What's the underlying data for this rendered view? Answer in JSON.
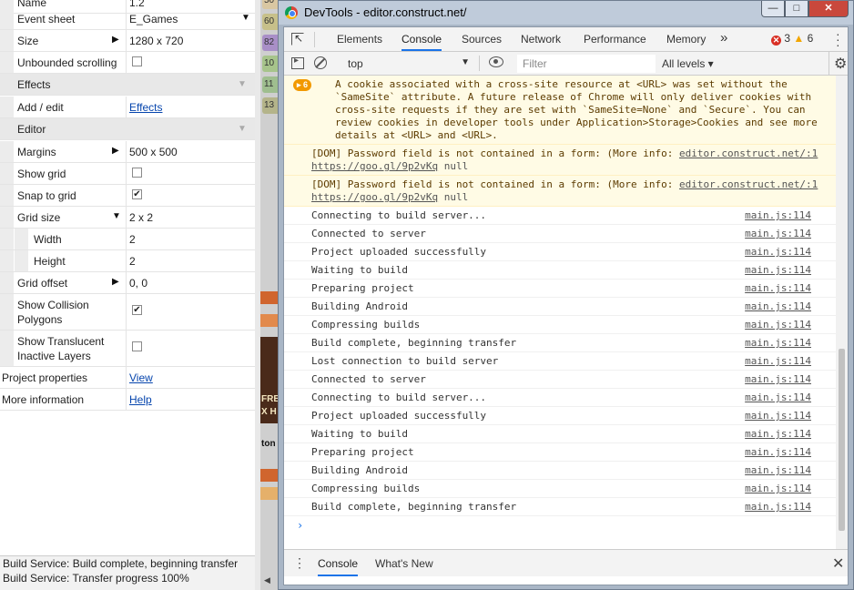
{
  "properties": {
    "rows": [
      {
        "type": "prop",
        "label": "Name",
        "value": "1.2"
      },
      {
        "type": "prop",
        "label": "Event sheet",
        "value": "E_Games",
        "control": "dropdown"
      },
      {
        "type": "prop",
        "label": "Size",
        "value": "1280 x 720",
        "control": "expand"
      },
      {
        "type": "prop",
        "label": "Unbounded scrolling",
        "control": "checkbox",
        "checked": false
      },
      {
        "type": "section",
        "label": "Effects"
      },
      {
        "type": "prop",
        "label": "Add / edit",
        "link": "Effects"
      },
      {
        "type": "section",
        "label": "Editor"
      },
      {
        "type": "prop",
        "label": "Margins",
        "value": "500 x 500",
        "control": "expand"
      },
      {
        "type": "prop",
        "label": "Show grid",
        "control": "checkbox",
        "checked": false
      },
      {
        "type": "prop",
        "label": "Snap to grid",
        "control": "checkbox",
        "checked": true
      },
      {
        "type": "prop",
        "label": "Grid size",
        "value": "2 x 2",
        "control": "expanded"
      },
      {
        "type": "sub",
        "label": "Width",
        "value": "2"
      },
      {
        "type": "sub",
        "label": "Height",
        "value": "2"
      },
      {
        "type": "prop",
        "label": "Grid offset",
        "value": "0, 0",
        "control": "expand"
      },
      {
        "type": "prop2",
        "label": "Show Collision Polygons",
        "control": "checkbox",
        "checked": true
      },
      {
        "type": "prop2",
        "label": "Show Translucent Inactive Layers",
        "control": "checkbox",
        "checked": false
      },
      {
        "type": "root",
        "label": "Project properties",
        "link": "View"
      },
      {
        "type": "root",
        "label": "More information",
        "link": "Help"
      }
    ],
    "status_lines": [
      "Build Service: Build complete, beginning transfer",
      "Build Service: Transfer progress 100%"
    ]
  },
  "canvas_strip": {
    "labels": [
      "50",
      "60",
      "82",
      "10",
      "11",
      "13"
    ],
    "fragments": [
      "FRE",
      "X H",
      "ton"
    ]
  },
  "devtools": {
    "window_title": "DevTools - editor.construct.net/",
    "window_buttons": {
      "minimize": "—",
      "maximize": "□",
      "close": "✕"
    },
    "tabs": [
      "Elements",
      "Console",
      "Sources",
      "Network",
      "Performance",
      "Memory"
    ],
    "active_tab": "Console",
    "more_tabs": "»",
    "errors": "3",
    "warnings": "6",
    "context": "top",
    "filter_placeholder": "Filter",
    "levels": "All levels ▾",
    "warnings_badge": "▸ 6",
    "messages_warn": [
      {
        "text": "A cookie associated with a cross-site resource at <URL> was set without the `SameSite` attribute. A future release of Chrome will only deliver cookies with cross-site requests if they are set with `SameSite=None` and `Secure`. You can review cookies in developer tools under Application>Storage>Cookies and see more details at <URL> and <URL>."
      },
      {
        "text": "[DOM] Password field is not contained in a form: (More info: ",
        "link1": "editor.construct.net/:1",
        "link2": "https://goo.gl/9p2vKq",
        "tail": " null"
      },
      {
        "text": "[DOM] Password field is not contained in a form: (More info: ",
        "link1": "editor.construct.net/:1",
        "link2": "https://goo.gl/9p2vKq",
        "tail": " null"
      }
    ],
    "messages": [
      {
        "text": "Connecting to build server...",
        "source": "main.js:114"
      },
      {
        "text": "Connected to server",
        "source": "main.js:114"
      },
      {
        "text": "Project uploaded successfully",
        "source": "main.js:114"
      },
      {
        "text": "Waiting to build",
        "source": "main.js:114"
      },
      {
        "text": "Preparing project",
        "source": "main.js:114"
      },
      {
        "text": "Building Android",
        "source": "main.js:114"
      },
      {
        "text": "Compressing builds",
        "source": "main.js:114"
      },
      {
        "text": "Build complete, beginning transfer",
        "source": "main.js:114"
      },
      {
        "text": "Lost connection to build server",
        "source": "main.js:114"
      },
      {
        "text": "Connected to server",
        "source": "main.js:114"
      },
      {
        "text": "Connecting to build server...",
        "source": "main.js:114"
      },
      {
        "text": "Project uploaded successfully",
        "source": "main.js:114"
      },
      {
        "text": "Waiting to build",
        "source": "main.js:114"
      },
      {
        "text": "Preparing project",
        "source": "main.js:114"
      },
      {
        "text": "Building Android",
        "source": "main.js:114"
      },
      {
        "text": "Compressing builds",
        "source": "main.js:114"
      },
      {
        "text": "Build complete, beginning transfer",
        "source": "main.js:114"
      }
    ],
    "prompt": "›",
    "drawer_tabs": [
      "Console",
      "What's New"
    ],
    "drawer_close": "✕"
  }
}
